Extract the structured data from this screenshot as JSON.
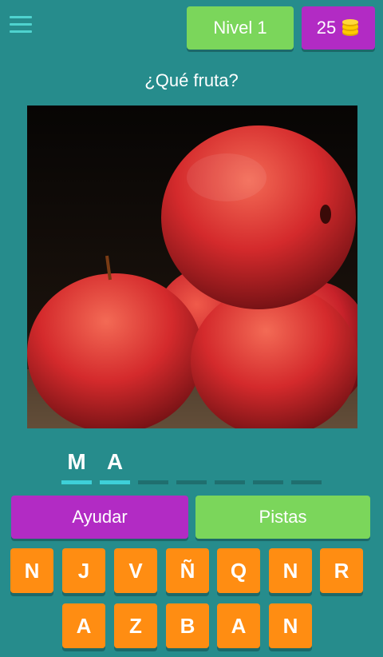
{
  "header": {
    "menu_icon": "hamburger-menu-icon",
    "level_label": "Nivel 1",
    "coins": "25",
    "coin_icon": "coin-stack-icon"
  },
  "question": "¿Qué fruta?",
  "image": {
    "subject": "red apples"
  },
  "answer_slots": [
    "M",
    "A",
    "",
    "",
    "",
    "",
    ""
  ],
  "buttons": {
    "help": "Ayudar",
    "hints": "Pistas"
  },
  "keyboard": {
    "row1": [
      "N",
      "J",
      "V",
      "Ñ",
      "Q",
      "N",
      "R"
    ],
    "row2": [
      "A",
      "Z",
      "B",
      "A",
      "N"
    ]
  },
  "colors": {
    "background": "#268c8c",
    "green_button": "#7bd65b",
    "purple_button": "#b22bc4",
    "key_orange": "#ff8d12",
    "slot_accent": "#3ed0d8"
  }
}
